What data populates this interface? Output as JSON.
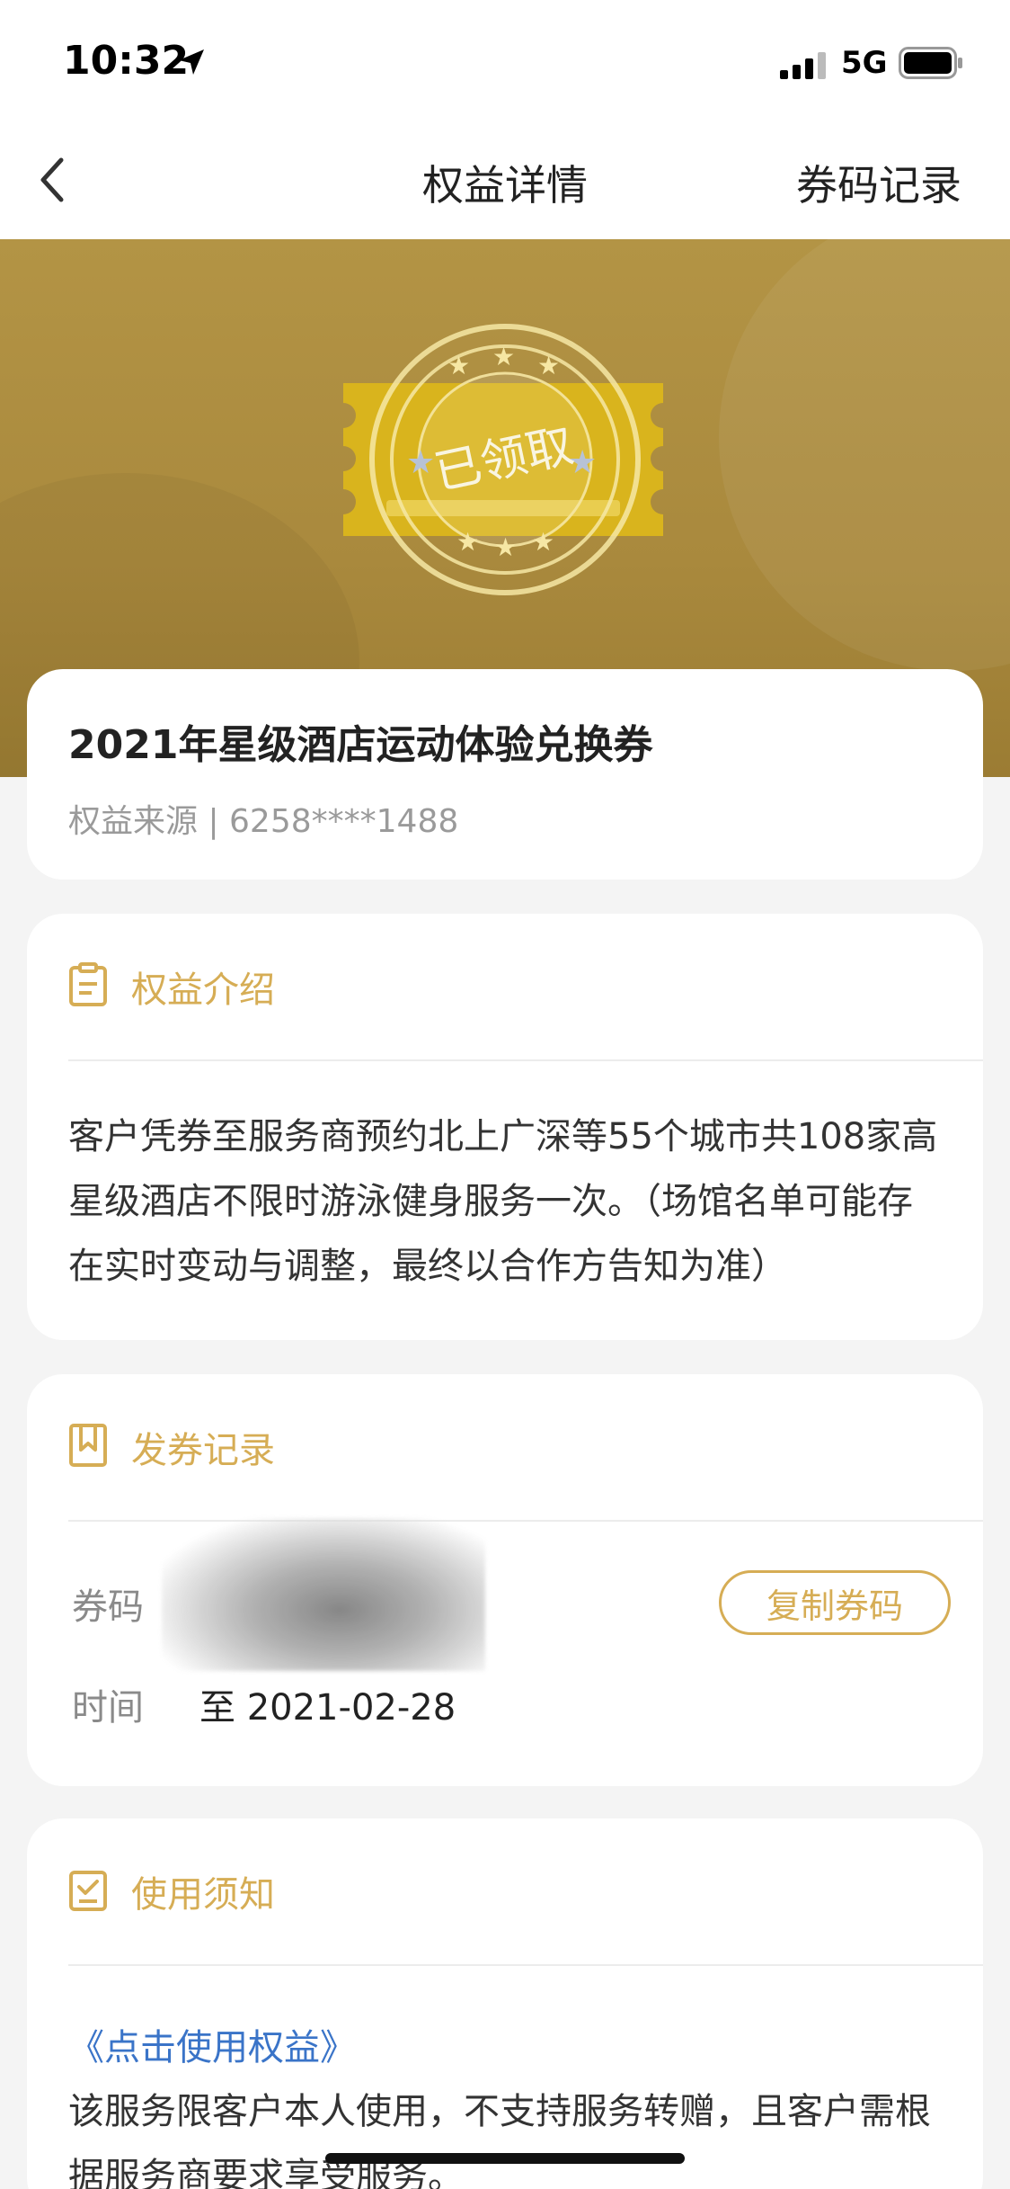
{
  "status_bar": {
    "time": "10:32",
    "network": "5G"
  },
  "nav": {
    "title": "权益详情",
    "right_action": "券码记录"
  },
  "banner": {
    "stamp_text": "已领取"
  },
  "summary": {
    "title": "2021年星级酒店运动体验兑换券",
    "source": "权益来源 | 6258****1488"
  },
  "intro": {
    "heading": "权益介绍",
    "text": "客户凭券至服务商预约北上广深等55个城市共108家高星级酒店不限时游泳健身服务一次。（场馆名单可能存在实时变动与调整，最终以合作方告知为准）"
  },
  "issue_record": {
    "heading": "发券记录",
    "code_label": "券码",
    "copy_button": "复制券码",
    "time_label": "时间",
    "time_value": "至 2021-02-28"
  },
  "usage": {
    "heading": "使用须知",
    "link": "《点击使用权益》",
    "text": "该服务限客户本人使用，不支持服务转赠，且客户需根据服务商要求享受服务。"
  },
  "colors": {
    "accent": "#d6ad55",
    "banner": "#a9893d",
    "link": "#3a74c8"
  }
}
